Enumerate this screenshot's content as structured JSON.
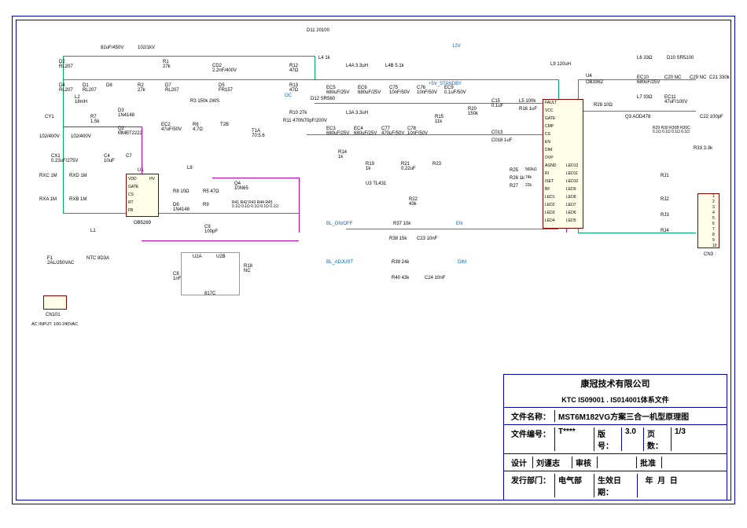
{
  "title_block": {
    "company": "康冠技术有限公司",
    "system": "KTC  IS09001 . IS014001体系文件",
    "file_name_label": "文件名称：",
    "file_name": "MST6M182VG方案三合一机型原理图",
    "file_code_label": "文件编号：",
    "file_code": "T****",
    "version_label": "版号：",
    "version": "3.0",
    "page_label": "页数：",
    "page": "1/3",
    "design_label": "设计",
    "designer": "刘谨志",
    "review_label": "审核",
    "reviewer": "",
    "approve_label": "批准",
    "approver": "",
    "dept_label": "发行部门：",
    "dept": "电气部",
    "date_label": "生效日期：",
    "date_y": "年",
    "date_m": "月",
    "date_d": "日"
  },
  "input_label": "AC INPUT: 100-240VAC",
  "connectors": {
    "cn101": "CN101",
    "cn3": "CN3"
  },
  "nets": {
    "standby": "+5V_STANDBY",
    "v12": "12V",
    "bl_on": "BL_ON/OFF",
    "bl_adj": "BL_ADJUST",
    "en": "EN",
    "dim": "DIM",
    "oc": "OC"
  },
  "components": {
    "EC1": "82uF/450V",
    "C01": "102/1kV",
    "D2": "RL207",
    "R1": "27k",
    "CD2": "2.2nF/400V",
    "D4": "RL207",
    "D1": "RL207",
    "D8": "",
    "R2": "27k",
    "D7": "RL207",
    "D5": "FR157",
    "L2": "18mH",
    "D3": "1N4148",
    "CY1": "",
    "R7": "1.5k",
    "C13": "102/400V",
    "C14": "102/400V",
    "Q2": "MMBT2222",
    "C03": "",
    "D9": "",
    "EC2": "47uF/50V",
    "R6": "4.7Ω",
    "T2B": "T2B",
    "T1A": "T1A",
    "T1A_val": "70:5.6",
    "CX1": "0.23uF/275V",
    "RXC": "RXC 1M",
    "RXD": "RXD 1M",
    "RXA": "RXA 1M",
    "RXB": "RXB 1M",
    "C4": "10uF",
    "C7": "",
    "U1": "U1",
    "U1_part": "OB5269",
    "U1_pins": [
      "GATE",
      "VDD",
      "CS",
      "RT",
      "FB",
      "HV"
    ],
    "L8": "L8",
    "R8": "10Ω",
    "R5": "47Ω",
    "D6": "1N4148",
    "R9": "",
    "Q4": "10N65",
    "R41": "R41",
    "R42": "R42",
    "R43": "R43",
    "R44": "R44",
    "R45": "R45",
    "R41_45_val": "0.1Ω 0.1Ω 0.1Ω 0.1Ω 0.1Ω",
    "C9": "100pF",
    "L1": "L1",
    "F1": "2AL/250VAC",
    "NTC": "NTC 8D3A",
    "U2A": "U2A",
    "U2B": "U2B",
    "C8": "1nF",
    "R18": "NC",
    "opto": "817C",
    "D11": "D11 20100",
    "R12": "47Ω",
    "L4": "L4 1k",
    "R13": "47Ω",
    "D12": "D12 SR560",
    "R10": "27k",
    "R11": "470N70pF/200V",
    "L4A": "L4A 3.3uH",
    "L4B": "L4B 5.1k",
    "EC5": "680uF/25V",
    "EC6": "680uF/25V",
    "C75": "10nF/50V",
    "C76": "10nF/50V",
    "EC9": "0.1uF/50V",
    "L3A": "L3A 3.3uH",
    "EC3": "680uF/25V",
    "EC4": "680uF/25V",
    "C77": "470uF/50V",
    "C78": "10nF/50V",
    "R15": "11k",
    "R20": "150k",
    "R14": "1k",
    "R19": "1k",
    "U3": "U3 TL431",
    "R21": "0.22uF",
    "R23": "",
    "R22": "43k",
    "R37": "10k",
    "R38": "R38 15k",
    "C23": "C23 10nF",
    "R39": "R39 24k",
    "R40": "R40 43k",
    "C24": "C24 10nF",
    "C15": "0.1uF",
    "C13b": "C013",
    "C18": "C018 1uF",
    "L5": "L5 100k",
    "R16": "R16 1uF",
    "L9": "L9 120uH",
    "U4": "U4",
    "U4_part": "OB3362",
    "U4_pins_left": [
      "FAULT",
      "VCC",
      "GATE",
      "CMP",
      "CS",
      "EN",
      "DIM",
      "OVP",
      "AGND",
      "RI",
      "ISET",
      "BF",
      "LED1",
      "LED2",
      "LED3",
      "LED4"
    ],
    "U4_pins_right": [
      "LED12",
      "LED11",
      "LED10",
      "LED9",
      "LED8",
      "LED7",
      "LED6",
      "LED5"
    ],
    "R25": "R25",
    "R26": "R26 1k",
    "R27": "R27",
    "RG1": "560kΩ",
    "RG2": "74k",
    "RG3": "22k",
    "R28": "R28 10Ω",
    "Q3": "Q3 AOD478",
    "L6": "L6 33Ω",
    "D10": "D10 SR5100",
    "L7": "L7 33Ω",
    "EC10": "680uF/25V",
    "C20": "C20 NC",
    "EC11": "47uF/100V",
    "C29": "C29 NC",
    "C21": "C21 330k",
    "R29": "R29",
    "R30": "R30",
    "R30B": "R30B",
    "R30C": "R30C",
    "R29_30_val": "0.1Ω 0.1Ω 0.1Ω 0.1Ω",
    "C22": "C22 100pF",
    "R33": "R33 3.3k",
    "RJ1": "RJ1",
    "RJ2": "RJ2",
    "RJ3": "RJ3",
    "RJ4": "RJ4",
    "R3": "R3 150k 2WS"
  },
  "cn3_pins": [
    "1",
    "2",
    "3",
    "4",
    "5",
    "6",
    "7",
    "8",
    "9",
    "10"
  ]
}
